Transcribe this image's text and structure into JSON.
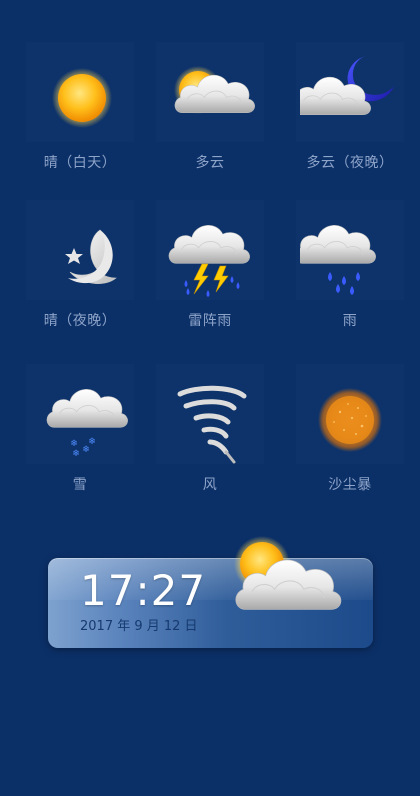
{
  "items": [
    {
      "label": "晴（白天）",
      "icon": "sun-icon"
    },
    {
      "label": "多云",
      "icon": "partly-cloudy-icon"
    },
    {
      "label": "多云（夜晚）",
      "icon": "cloudy-night-icon"
    },
    {
      "label": "晴（夜晚）",
      "icon": "clear-night-icon"
    },
    {
      "label": "雷阵雨",
      "icon": "thunderstorm-icon"
    },
    {
      "label": "雨",
      "icon": "rain-icon"
    },
    {
      "label": "雪",
      "icon": "snow-icon"
    },
    {
      "label": "风",
      "icon": "wind-icon"
    },
    {
      "label": "沙尘暴",
      "icon": "sandstorm-icon"
    }
  ],
  "widget": {
    "time": "17:27",
    "date": "2017 年 9 月 12 日",
    "icon": "partly-cloudy-icon"
  },
  "colors": {
    "background": "#0b3068",
    "label": "#8ea3c8",
    "sun": "#ffb300",
    "moon": "#2a2fcf"
  }
}
